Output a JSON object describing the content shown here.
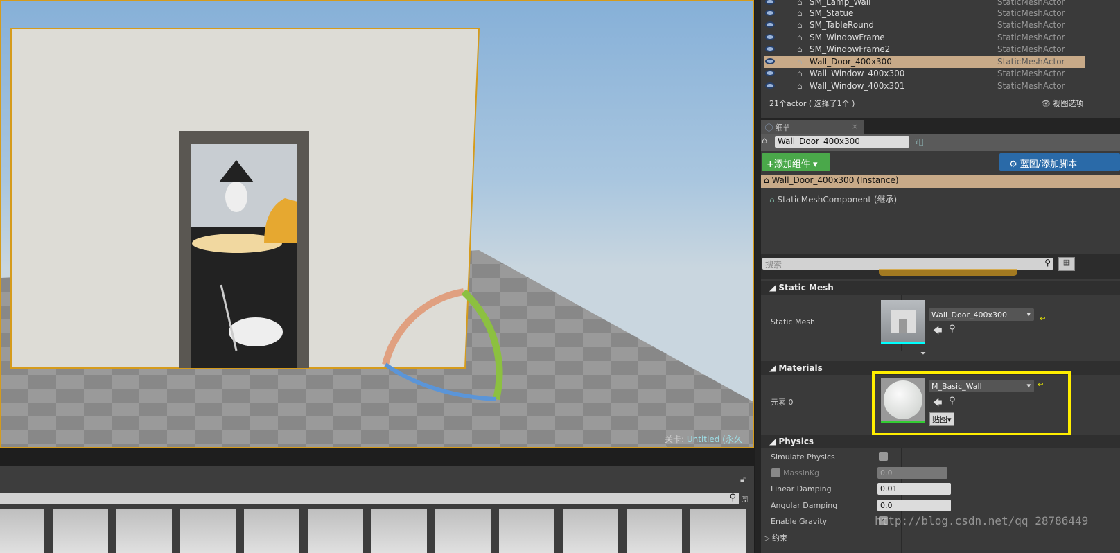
{
  "viewport": {
    "level_label": "关卡:",
    "level_name": "Untitled (永久性)"
  },
  "outliner": {
    "rows": [
      {
        "name": "SM_Lamp_Wall",
        "type": "StaticMeshActor",
        "selected": false
      },
      {
        "name": "SM_Statue",
        "type": "StaticMeshActor",
        "selected": false
      },
      {
        "name": "SM_TableRound",
        "type": "StaticMeshActor",
        "selected": false
      },
      {
        "name": "SM_WindowFrame",
        "type": "StaticMeshActor",
        "selected": false
      },
      {
        "name": "SM_WindowFrame2",
        "type": "StaticMeshActor",
        "selected": false
      },
      {
        "name": "Wall_Door_400x300",
        "type": "StaticMeshActor",
        "selected": true
      },
      {
        "name": "Wall_Window_400x300",
        "type": "StaticMeshActor",
        "selected": false
      },
      {
        "name": "Wall_Window_400x301",
        "type": "StaticMeshActor",
        "selected": false
      }
    ],
    "footer": "21个actor ( 选择了1个 )",
    "view_options": "视图选项"
  },
  "details": {
    "tab": "细节",
    "name_value": "Wall_Door_400x300",
    "add_component": "添加组件",
    "blueprint_button": "蓝图/添加脚本",
    "instance": "Wall_Door_400x300 (Instance)",
    "component": "StaticMeshComponent (继承)",
    "search_placeholder": "搜索",
    "static_mesh": {
      "header": "Static Mesh",
      "label": "Static Mesh",
      "value": "Wall_Door_400x300"
    },
    "materials": {
      "header": "Materials",
      "label": "元素 0",
      "value": "M_Basic_Wall",
      "textures_button": "贴图"
    },
    "physics": {
      "header": "Physics",
      "simulate": "Simulate Physics",
      "mass": "MassInKg",
      "mass_value": "0.0",
      "linear": "Linear Damping",
      "linear_value": "0.01",
      "angular": "Angular Damping",
      "angular_value": "0.0",
      "gravity": "Enable Gravity",
      "next": "约束"
    }
  },
  "watermark": "http://blog.csdn.net/qq_28786449",
  "colors": {
    "highlight": "#ffee00",
    "selection": "#c8aa88",
    "add_green": "#4aa84a",
    "blueprint_blue": "#2a6aa8"
  }
}
